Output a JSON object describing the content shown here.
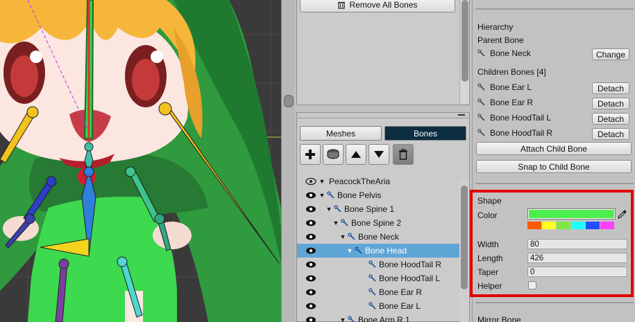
{
  "toolbar_top": {
    "remove_all_label": "Remove All Bones"
  },
  "tabs": {
    "meshes": "Meshes",
    "bones": "Bones"
  },
  "tree": {
    "root": "PeacockTheAria",
    "items": [
      {
        "label": "Bone Pelvis",
        "arrow": "▼",
        "selected": false
      },
      {
        "label": "Bone Spine 1",
        "arrow": "▼",
        "selected": false
      },
      {
        "label": "Bone Spine 2",
        "arrow": "▼",
        "selected": false
      },
      {
        "label": "Bone Neck",
        "arrow": "▼",
        "selected": false
      },
      {
        "label": "Bone Head",
        "arrow": "▼",
        "selected": true
      },
      {
        "label": "Bone HoodTail R",
        "arrow": "",
        "selected": false
      },
      {
        "label": "Bone HoodTail L",
        "arrow": "",
        "selected": false
      },
      {
        "label": "Bone Ear R",
        "arrow": "",
        "selected": false
      },
      {
        "label": "Bone Ear L",
        "arrow": "",
        "selected": false
      },
      {
        "label": "Bone Arm R 1",
        "arrow": "▼",
        "selected": false
      }
    ]
  },
  "inspector": {
    "hierarchy_label": "Hierarchy",
    "parent_bone_label": "Parent Bone",
    "parent_bone_value": "Bone Neck",
    "change_label": "Change",
    "children_label": "Children Bones [4]",
    "children": [
      {
        "name": "Bone Ear L",
        "button": "Detach"
      },
      {
        "name": "Bone Ear R",
        "button": "Detach"
      },
      {
        "name": "Bone HoodTail L",
        "button": "Detach"
      },
      {
        "name": "Bone HoodTail R",
        "button": "Detach"
      }
    ],
    "attach_child_label": "Attach Child Bone",
    "snap_child_label": "Snap to Child Bone",
    "shape_label": "Shape",
    "color_label": "Color",
    "color_value": "#4ded4d",
    "palette": [
      "#ff5a00",
      "#ffff20",
      "#80e840",
      "#20ffff",
      "#2050ff",
      "#ff40ff"
    ],
    "width_label": "Width",
    "width_value": "80",
    "length_label": "Length",
    "length_value": "426",
    "taper_label": "Taper",
    "taper_value": "0",
    "helper_label": "Helper",
    "helper_checked": false,
    "mirror_label": "Mirror Bone"
  },
  "colors": {
    "selection": "#5fa6d6",
    "bones_tab": "#0c2d40",
    "highlight": "#e20000"
  }
}
